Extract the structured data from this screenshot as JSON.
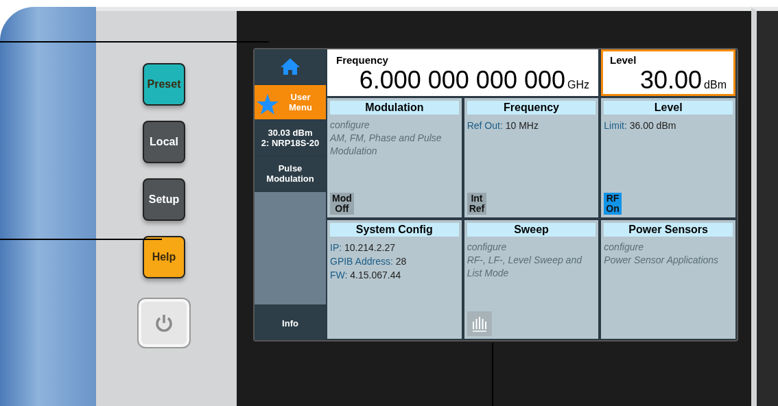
{
  "keys": [
    {
      "kind": "key",
      "label": "Preset",
      "color": "#1fb5b8"
    },
    {
      "kind": "key",
      "label": "Local",
      "color": "#505457"
    },
    {
      "kind": "key",
      "label": "Setup",
      "color": "#505457"
    },
    {
      "kind": "key",
      "label": "Help",
      "color": "#f7a614"
    },
    {
      "kind": "power"
    }
  ],
  "sidebar": [
    {
      "kind": "home"
    },
    {
      "kind": "user",
      "lines": [
        "User",
        "Menu"
      ]
    },
    {
      "kind": "text",
      "lines": [
        "30.03 dBm",
        "2: NRP18S-20"
      ]
    },
    {
      "kind": "text",
      "lines": [
        "Pulse",
        "Modulation"
      ]
    },
    {
      "kind": "spacer"
    },
    {
      "kind": "text",
      "lines": [
        "Info"
      ]
    }
  ],
  "frequency": {
    "label": "Frequency",
    "value": "6.000 000 000 000",
    "unit": "GHz",
    "selected": false
  },
  "level": {
    "label": "Level",
    "value": "30.00",
    "unit": "dBm",
    "selected": true
  },
  "tiles": [
    {
      "title": "Modulation",
      "lines": [
        {
          "kind": "hint",
          "text": "configure"
        },
        {
          "kind": "hint",
          "text": "AM, FM, Phase and Pulse Modulation"
        }
      ],
      "footer": {
        "kind": "toggle",
        "lines": [
          "Mod",
          "Off"
        ],
        "on": false
      }
    },
    {
      "title": "Frequency",
      "lines": [
        {
          "kind": "param",
          "label": "Ref Out:",
          "value": "10 MHz"
        }
      ],
      "footer": {
        "kind": "toggle",
        "lines": [
          "Int",
          "Ref"
        ],
        "on": false
      }
    },
    {
      "title": "Level",
      "lines": [
        {
          "kind": "param",
          "label": "Limit:",
          "value": "36.00 dBm"
        }
      ],
      "footer": {
        "kind": "toggle",
        "lines": [
          "RF",
          "On"
        ],
        "on": true
      }
    },
    {
      "title": "System Config",
      "lines": [
        {
          "kind": "param",
          "label": "IP:",
          "value": "10.214.2.27"
        },
        {
          "kind": "param",
          "label": "GPIB Address:",
          "value": "28"
        },
        {
          "kind": "param",
          "label": "FW:",
          "value": "4.15.067.44"
        }
      ]
    },
    {
      "title": "Sweep",
      "lines": [
        {
          "kind": "hint",
          "text": "configure"
        },
        {
          "kind": "hint",
          "text": "RF-, LF-, Level Sweep and List Mode"
        }
      ],
      "footer": {
        "kind": "icon"
      }
    },
    {
      "title": "Power Sensors",
      "lines": [
        {
          "kind": "hint",
          "text": "configure"
        },
        {
          "kind": "hint",
          "text": "Power Sensor Applications"
        }
      ]
    }
  ]
}
